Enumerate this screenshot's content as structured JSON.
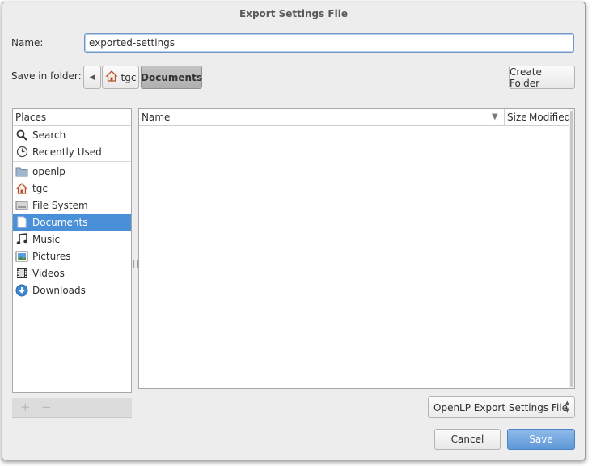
{
  "dialog": {
    "title": "Export Settings File",
    "name_label": "Name:",
    "name_value": "exported-settings",
    "folder_label": "Save in folder:",
    "path": {
      "back_glyph": "◀",
      "segments": [
        {
          "label": "tgc",
          "icon": "home-icon"
        },
        {
          "label": "Documents",
          "active": true
        }
      ]
    },
    "create_folder_label": "Create Folder"
  },
  "places": {
    "header": "Places",
    "items": [
      {
        "label": "Search",
        "icon": "search-icon"
      },
      {
        "label": "Recently Used",
        "icon": "clock-icon"
      },
      {
        "label": "openlp",
        "icon": "folder-icon"
      },
      {
        "label": "tgc",
        "icon": "home-icon"
      },
      {
        "label": "File System",
        "icon": "drive-icon"
      },
      {
        "label": "Documents",
        "icon": "document-icon",
        "selected": true
      },
      {
        "label": "Music",
        "icon": "music-icon"
      },
      {
        "label": "Pictures",
        "icon": "pictures-icon"
      },
      {
        "label": "Videos",
        "icon": "film-icon"
      },
      {
        "label": "Downloads",
        "icon": "download-icon"
      }
    ],
    "add_glyph": "+",
    "remove_glyph": "−"
  },
  "files": {
    "columns": {
      "name": "Name",
      "size": "Size",
      "modified": "Modified"
    },
    "sort_glyph": "▼",
    "rows": []
  },
  "filter": {
    "selected": "OpenLP Export Settings File"
  },
  "buttons": {
    "cancel": "Cancel",
    "save": "Save"
  },
  "colors": {
    "selection": "#4a90d9",
    "save_button": "#5e98d8"
  }
}
